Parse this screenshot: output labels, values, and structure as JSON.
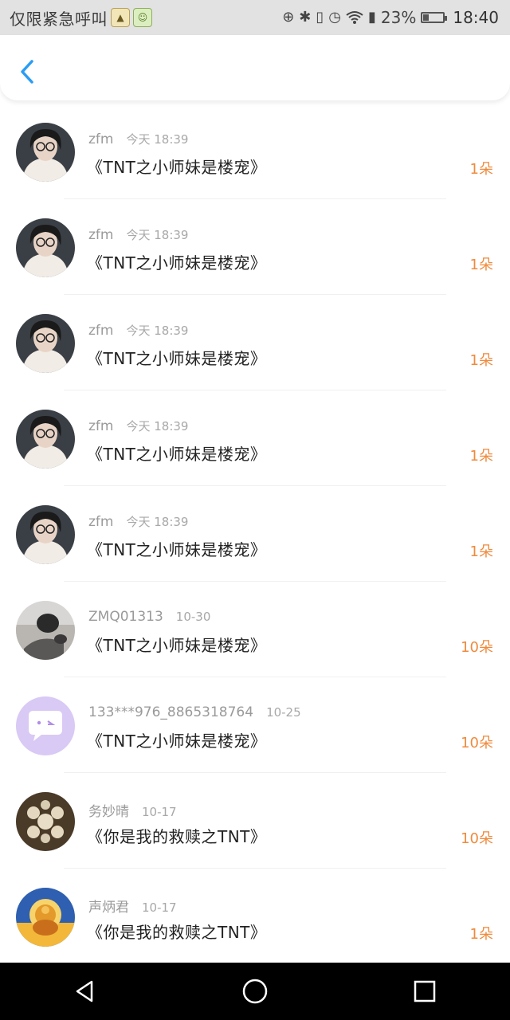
{
  "status_bar": {
    "carrier_text": "仅限紧急呼叫",
    "battery_percent": "23%",
    "time": "18:40",
    "icons": [
      "app-notification-icon",
      "app-notification-icon-2",
      "hd-icon",
      "bluetooth-icon",
      "vibrate-icon",
      "alarm-icon",
      "wifi-icon",
      "battery-saver-icon",
      "battery-icon"
    ]
  },
  "header": {
    "back_icon": "chevron-left-icon",
    "accent_color": "#2a9df4"
  },
  "list": {
    "count_color": "#f08a3c",
    "items": [
      {
        "name": "zfm",
        "time": "今天 18:39",
        "title": "《TNT之小师妹是楼宠》",
        "count": "1朵",
        "avatar": "portrait-glasses"
      },
      {
        "name": "zfm",
        "time": "今天 18:39",
        "title": "《TNT之小师妹是楼宠》",
        "count": "1朵",
        "avatar": "portrait-glasses"
      },
      {
        "name": "zfm",
        "time": "今天 18:39",
        "title": "《TNT之小师妹是楼宠》",
        "count": "1朵",
        "avatar": "portrait-glasses"
      },
      {
        "name": "zfm",
        "time": "今天 18:39",
        "title": "《TNT之小师妹是楼宠》",
        "count": "1朵",
        "avatar": "portrait-glasses"
      },
      {
        "name": "zfm",
        "time": "今天 18:39",
        "title": "《TNT之小师妹是楼宠》",
        "count": "1朵",
        "avatar": "portrait-glasses"
      },
      {
        "name": "ZMQ01313",
        "time": "10-30",
        "title": "《TNT之小师妹是楼宠》",
        "count": "10朵",
        "avatar": "grey-photo"
      },
      {
        "name": "133***976_8865318764",
        "time": "10-25",
        "title": "《TNT之小师妹是楼宠》",
        "count": "10朵",
        "avatar": "purple-chat-bubble"
      },
      {
        "name": "务妙晴",
        "time": "10-17",
        "title": "《你是我的救赎之TNT》",
        "count": "10朵",
        "avatar": "pearl-brooch"
      },
      {
        "name": "声炳君",
        "time": "10-17",
        "title": "《你是我的救赎之TNT》",
        "count": "1朵",
        "avatar": "golden-buddha"
      }
    ]
  },
  "nav_bar": {
    "icons": [
      "back-triangle-icon",
      "home-circle-icon",
      "recents-square-icon"
    ]
  }
}
